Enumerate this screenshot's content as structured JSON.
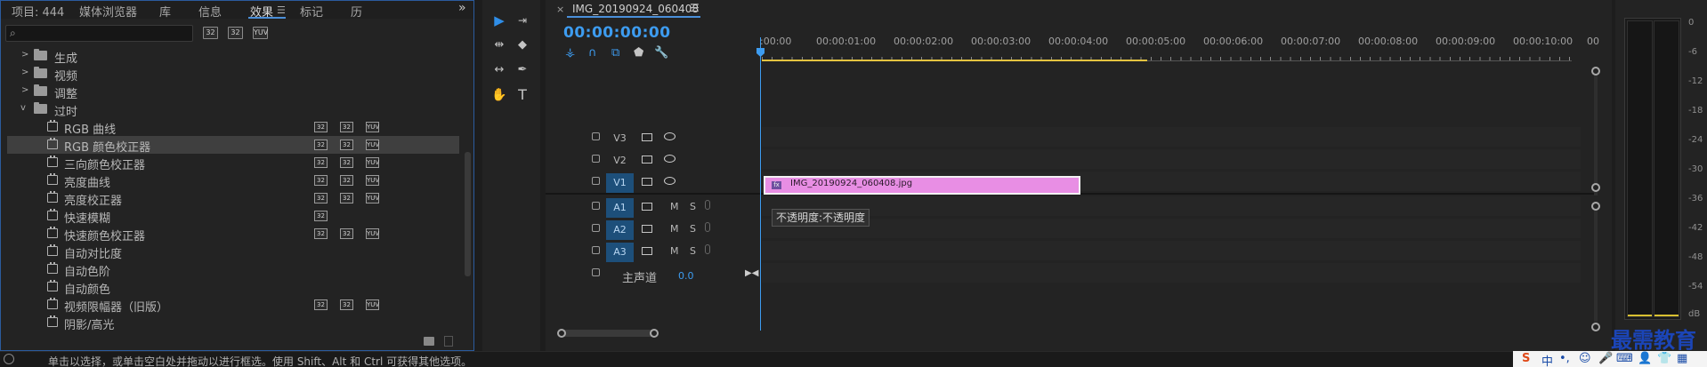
{
  "effects_panel": {
    "tabs": [
      "项目: 444",
      "媒体浏览器",
      "库",
      "信息",
      "效果",
      "标记",
      "历"
    ],
    "active_tab": "效果",
    "menu_glyph": "☰",
    "overflow_glyph": "»",
    "search_placeholder": "",
    "filter_badges": [
      "32",
      "32",
      "YUV"
    ],
    "folders": [
      "生成",
      "视频",
      "调整",
      "过时"
    ],
    "effects": [
      {
        "label": "RGB 曲线",
        "badges": [
          "32",
          "32",
          "YUV"
        ]
      },
      {
        "label": "RGB 颜色校正器",
        "badges": [
          "32",
          "32",
          "YUV"
        ]
      },
      {
        "label": "三向颜色校正器",
        "badges": [
          "32",
          "32",
          "YUV"
        ]
      },
      {
        "label": "亮度曲线",
        "badges": [
          "32",
          "32",
          "YUV"
        ]
      },
      {
        "label": "亮度校正器",
        "badges": [
          "32",
          "32",
          "YUV"
        ]
      },
      {
        "label": "快速模糊",
        "badges": [
          "32"
        ]
      },
      {
        "label": "快速颜色校正器",
        "badges": [
          "32",
          "32",
          "YUV"
        ]
      },
      {
        "label": "自动对比度",
        "badges": []
      },
      {
        "label": "自动色阶",
        "badges": []
      },
      {
        "label": "自动颜色",
        "badges": []
      },
      {
        "label": "视频限幅器（旧版）",
        "badges": [
          "32",
          "32",
          "YUV"
        ]
      },
      {
        "label": "阴影/高光",
        "badges": []
      }
    ]
  },
  "timeline": {
    "sequence_name": "IMG_20190924_060408",
    "close_glyph": "×",
    "menu_glyph": "☰",
    "timecode": "00:00:00:00",
    "ruler_labels": [
      ":00:00",
      "00:00:01:00",
      "00:00:02:00",
      "00:00:03:00",
      "00:00:04:00",
      "00:00:05:00",
      "00:00:06:00",
      "00:00:07:00",
      "00:00:08:00",
      "00:00:09:00",
      "00:00:10:00",
      "00"
    ],
    "video_tracks": [
      "V3",
      "V2",
      "V1"
    ],
    "audio_tracks": [
      "A1",
      "A2",
      "A3"
    ],
    "mute_label": "M",
    "solo_label": "S",
    "master_label": "主声道",
    "master_value": "0.0",
    "clip_name": "IMG_20190924_060408.jpg",
    "clip_fx_badge": "fx",
    "clip_color": "#e88ee4",
    "tooltip": "不透明度:不透明度"
  },
  "tools": {
    "text_tool": "T"
  },
  "audio_meter": {
    "db_labels": [
      "0",
      "-6",
      "-12",
      "-18",
      "-24",
      "-30",
      "-36",
      "-42",
      "-48",
      "-54",
      "dB"
    ]
  },
  "status_bar": {
    "text": "单击以选择，或单击空白处并拖动以进行框选。使用 Shift、Alt 和 Ctrl 可获得其他选项。"
  },
  "ime": {
    "logo": "S",
    "mode": "中",
    "punct": "•,"
  },
  "watermark": "最需教育",
  "accent_color": "#3d9cf0"
}
